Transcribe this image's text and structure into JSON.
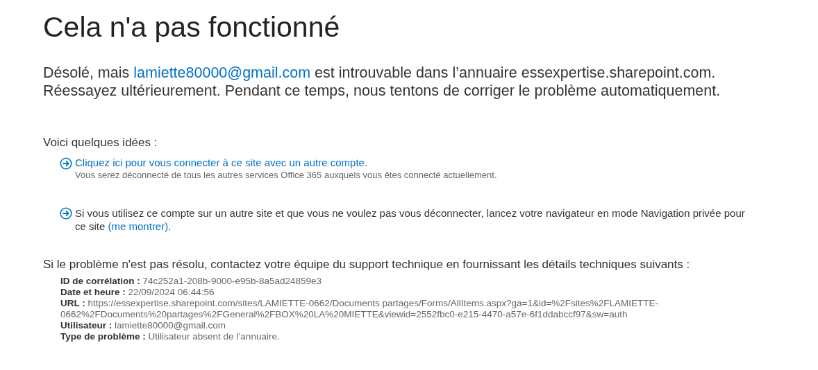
{
  "title": "Cela n'a pas fonctionné",
  "message": {
    "before": "Désolé, mais ",
    "link": "lamiette80000@gmail.com",
    "after": " est introuvable dans l’annuaire essexpertise.sharepoint.com. Réessayez ultérieurement. Pendant ce temps, nous tentons de corriger le problème automatiquement."
  },
  "ideas_heading": "Voici quelques idées :",
  "ideas": [
    {
      "kind": "link",
      "link": "Cliquez ici pour vous connecter à ce site avec un autre compte.",
      "note": "Vous serez déconnecté de tous les autres services Office 365 auxquels vous êtes connecté actuellement."
    },
    {
      "kind": "text",
      "text": "Si vous utilisez ce compte sur un autre site et que vous ne voulez pas vous déconnecter, lancez votre navigateur en mode Navigation privée pour ce site ",
      "link": "(me montrer)",
      "after": "."
    }
  ],
  "support_text": "Si le problème n'est pas résolu, contactez votre équipe du support technique en fournissant les détails techniques suivants :",
  "details": [
    {
      "label": "ID de corrélation :",
      "value": "74c252a1-208b-9000-e95b-8a5ad24859e3"
    },
    {
      "label": "Date et heure :",
      "value": "22/09/2024 06:44:56"
    },
    {
      "label": "URL :",
      "value": "https://essexpertise.sharepoint.com/sites/LAMIETTE-0662/Documents partages/Forms/AllItems.aspx?ga=1&id=%2Fsites%2FLAMIETTE-0662%2FDocuments%20partages%2FGeneral%2FBOX%20LA%20MIETTE&viewid=2552fbc0-e215-4470-a57e-6f1ddabccf97&sw=auth"
    },
    {
      "label": "Utilisateur :",
      "value": "lamiette80000@gmail.com"
    },
    {
      "label": "Type de problème :",
      "value": "Utilisateur absent de l’annuaire."
    }
  ]
}
